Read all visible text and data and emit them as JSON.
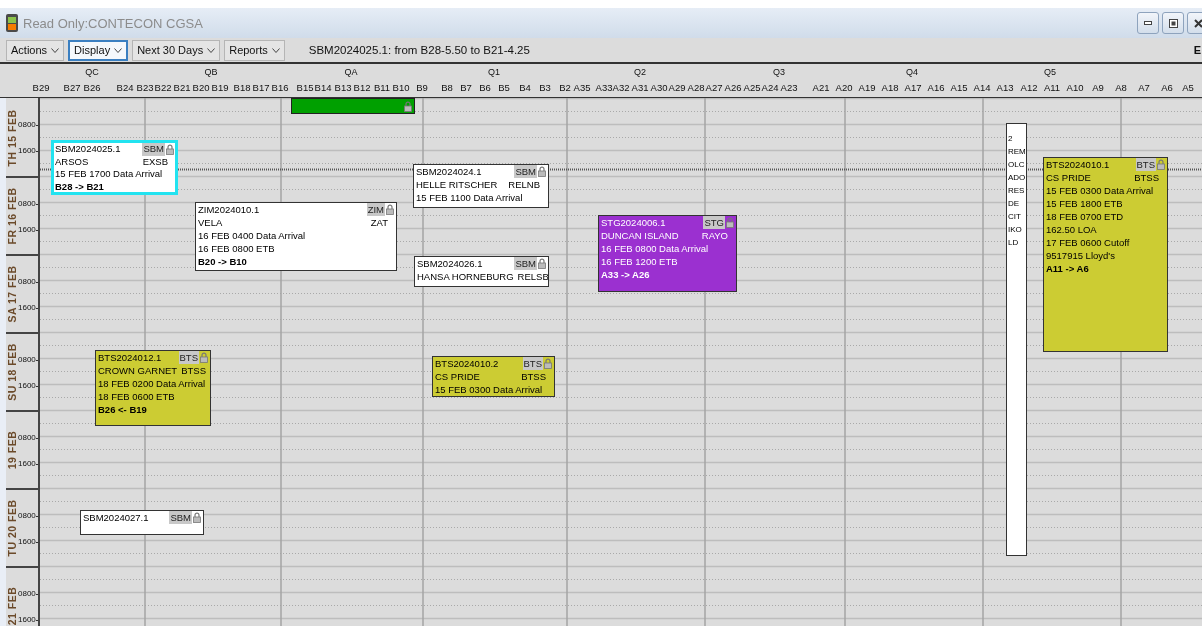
{
  "window": {
    "title": "Read Only:CONTECON CGSA"
  },
  "toolbar": {
    "menus": [
      {
        "label": "Actions",
        "focused": false
      },
      {
        "label": "Display",
        "focused": true
      },
      {
        "label": "Next 30 Days",
        "focused": false
      },
      {
        "label": "Reports",
        "focused": false
      }
    ],
    "status": "SBM2024025.1: from B28-5.50 to B21-4.25",
    "edge_text": "E"
  },
  "quays": [
    "QC",
    "QB",
    "QA",
    "Q1",
    "Q2",
    "Q3",
    "Q4",
    "Q5"
  ],
  "berths": [
    "B29",
    "B27",
    "B26",
    "B24",
    "B23",
    "B22",
    "B21",
    "B20",
    "B19",
    "B18",
    "B17",
    "B16",
    "B15",
    "B14",
    "B13",
    "B12",
    "B11",
    "B10",
    "B9",
    "B8",
    "B7",
    "B6",
    "B5",
    "B4",
    "B3",
    "B2",
    "A35",
    "A33",
    "A32",
    "A31",
    "A30",
    "A29",
    "A28",
    "A27",
    "A26",
    "A25",
    "A24",
    "A23",
    "A21",
    "A20",
    "A19",
    "A18",
    "A17",
    "A16",
    "A15",
    "A14",
    "A13",
    "A12",
    "A11",
    "A10",
    "A9",
    "A8",
    "A7",
    "A6",
    "A5"
  ],
  "days": [
    {
      "label": "TH 15 FEB",
      "times": [
        "0800",
        "1600"
      ]
    },
    {
      "label": "FR 16 FEB",
      "times": [
        "0800",
        "1600"
      ]
    },
    {
      "label": "SA 17 FEB",
      "times": [
        "0800",
        "1600"
      ]
    },
    {
      "label": "SU 18 FEB",
      "times": [
        "0800",
        "1600"
      ]
    },
    {
      "label": "19 FEB",
      "times": [
        "0800",
        "1600"
      ]
    },
    {
      "label": "TU 20 FEB",
      "times": [
        "0800",
        "1600"
      ]
    },
    {
      "label": "21 FEB",
      "times": [
        "0800",
        "1600"
      ]
    }
  ],
  "vessels": [
    {
      "kind": "bar",
      "color": "#00a000",
      "locked": true,
      "selected": false
    },
    {
      "kind": "card",
      "code": "SBM2024025.1",
      "line": "SBM",
      "name": "ARSOS",
      "operator": "EXSB",
      "events": [
        "15 FEB 1700 Data Arrival"
      ],
      "route": "B28 -> B21",
      "color": "#ffffff",
      "locked": true,
      "selected": true
    },
    {
      "kind": "card",
      "code": "SBM2024024.1",
      "line": "SBM",
      "name": "HELLE RITSCHER",
      "operator": "RELNB",
      "events": [
        "15 FEB 1100 Data Arrival"
      ],
      "color": "#ffffff",
      "locked": true,
      "selected": false
    },
    {
      "kind": "card",
      "code": "ZIM2024010.1",
      "line": "ZIM",
      "name": "VELA",
      "operator": "ZAT",
      "events": [
        "16 FEB 0400 Data Arrival",
        "16 FEB 0800 ETB"
      ],
      "route": "B20 -> B10",
      "color": "#ffffff",
      "locked": true,
      "selected": false
    },
    {
      "kind": "card",
      "code": "SBM2024026.1",
      "line": "SBM",
      "name": "HANSA HORNEBURG",
      "operator": "RELSB",
      "color": "#ffffff",
      "locked": true,
      "selected": false
    },
    {
      "kind": "card",
      "code": "STG2024006.1",
      "line": "STG",
      "name": "DUNCAN ISLAND",
      "operator": "RAYO",
      "events": [
        "16 FEB 0800 Data Arrival",
        "16 FEB 1200 ETB"
      ],
      "route": "A33 -> A26",
      "color": "#9b30d0",
      "locked": true,
      "selected": false
    },
    {
      "kind": "card",
      "code": "BTS2024012.1",
      "line": "BTS",
      "name": "CROWN GARNET",
      "operator": "BTSS",
      "events": [
        "18 FEB 0200 Data Arrival",
        "18 FEB 0600 ETB"
      ],
      "route": "B26 <- B19",
      "color": "#cccc33",
      "locked": true,
      "selected": false
    },
    {
      "kind": "card",
      "code": "BTS2024010.2",
      "line": "BTS",
      "name": "CS PRIDE",
      "operator": "BTSS",
      "events": [
        "15 FEB 0300 Data Arrival"
      ],
      "color": "#cccc33",
      "locked": true,
      "selected": false
    },
    {
      "kind": "card",
      "code": "BTS2024010.1",
      "line": "BTS",
      "name": "CS PRIDE",
      "operator": "BTSS",
      "events": [
        "15 FEB 0300 Data Arrival",
        "15 FEB 1800 ETB",
        "18 FEB 0700 ETD",
        "162.50 LOA",
        "17 FEB 0600 Cutoff",
        "9517915 Lloyd's"
      ],
      "route": "A11 -> A6",
      "color": "#cccc33",
      "locked": true,
      "selected": false
    },
    {
      "kind": "card",
      "code": "SBM2024027.1",
      "line": "SBM",
      "color": "#ffffff",
      "locked": true,
      "selected": false
    }
  ],
  "remarks": [
    "2",
    "REM",
    "OLC",
    "ADO",
    "RES",
    "DE",
    "CIT",
    "IKO",
    "LD"
  ]
}
